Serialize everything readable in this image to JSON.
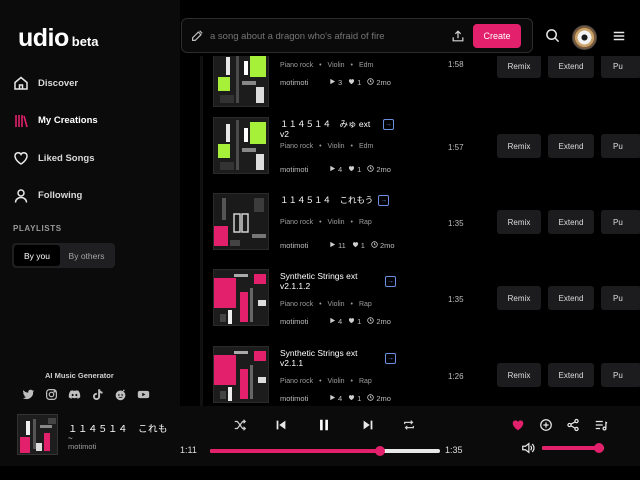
{
  "brand": {
    "name": "udio",
    "badge": "beta"
  },
  "nav": [
    {
      "id": "discover",
      "label": "Discover",
      "icon": "home-icon"
    },
    {
      "id": "my-creations",
      "label": "My Creations",
      "icon": "library-icon"
    },
    {
      "id": "liked-songs",
      "label": "Liked Songs",
      "icon": "heart-icon"
    },
    {
      "id": "following",
      "label": "Following",
      "icon": "user-icon"
    }
  ],
  "playlists": {
    "label": "PLAYLISTS",
    "options": [
      "By you",
      "By others"
    ],
    "selected": "By you"
  },
  "footer": {
    "tagline": "AI Music Generator",
    "socials": [
      "twitter-icon",
      "instagram-icon",
      "discord-icon",
      "tiktok-icon",
      "reddit-icon",
      "youtube-icon"
    ]
  },
  "search": {
    "placeholder": "a song about a dragon who's afraid of fire",
    "value": ""
  },
  "header": {
    "create_label": "Create"
  },
  "colors": {
    "accent": "#e3206b",
    "link_icon": "#6c8de0",
    "background": "#000000",
    "sidebar": "#0b0b0c",
    "button": "#1c1c1f"
  },
  "actions": {
    "remix": "Remix",
    "extend": "Extend",
    "publish": "Pu"
  },
  "songs": [
    {
      "title": "",
      "tags": [
        "Piano rock",
        "Violin",
        "Edm"
      ],
      "user": "motimoti",
      "plays": "3",
      "likes": "1",
      "age": "2mo",
      "duration": "1:58",
      "art": "lime",
      "has_link": false
    },
    {
      "title": "１１４５１４　みゅ ext v2",
      "tags": [
        "Piano rock",
        "Violin",
        "Edm"
      ],
      "user": "motimoti",
      "plays": "4",
      "likes": "1",
      "age": "2mo",
      "duration": "1:57",
      "art": "lime",
      "has_link": true
    },
    {
      "title": "１１４５１４　これもう",
      "tags": [
        "Piano rock",
        "Violin",
        "Rap"
      ],
      "user": "motimoti",
      "plays": "11",
      "likes": "1",
      "age": "2mo",
      "duration": "1:35",
      "art": "dark",
      "has_link": true
    },
    {
      "title": "Synthetic Strings ext v2.1.1.2",
      "tags": [
        "Piano rock",
        "Violin",
        "Rap"
      ],
      "user": "motimoti",
      "plays": "4",
      "likes": "1",
      "age": "2mo",
      "duration": "1:35",
      "art": "pink",
      "has_link": true
    },
    {
      "title": "Synthetic Strings ext v2.1.1",
      "tags": [
        "Piano rock",
        "Violin",
        "Rap"
      ],
      "user": "motimoti",
      "plays": "4",
      "likes": "1",
      "age": "2mo",
      "duration": "1:26",
      "art": "pink",
      "has_link": true
    }
  ],
  "player": {
    "title": "１１４５１４　これも",
    "subtitle": "~",
    "user": "motimoti",
    "current_time": "1:11",
    "total_time": "1:35",
    "progress": 0.74,
    "volume": 0.92,
    "liked": true
  }
}
